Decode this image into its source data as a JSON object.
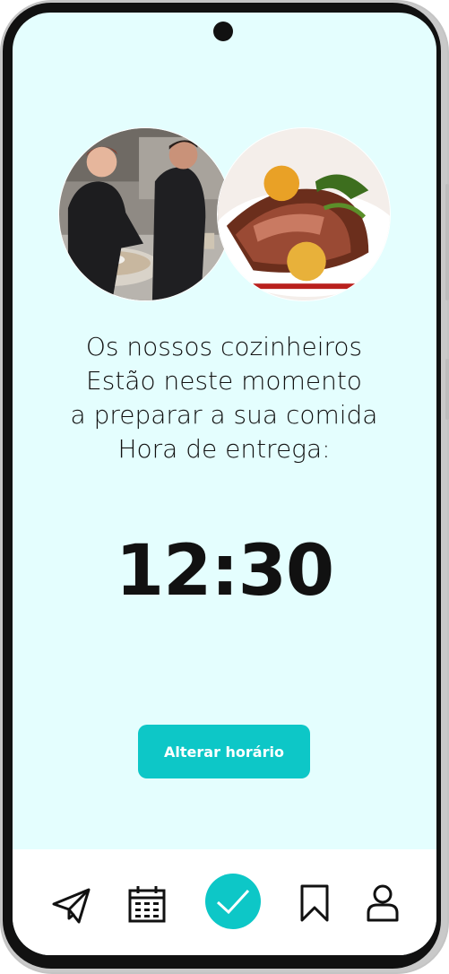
{
  "message": {
    "line1": "Os nossos cozinheiros",
    "line2": "Estão neste momento",
    "line3": "a preparar a sua comida",
    "line4": "Hora de entrega:"
  },
  "delivery_time": "12:30",
  "change_button_label": "Alterar horário",
  "colors": {
    "accent": "#0dc7c7",
    "screen_background": "#e4fefe",
    "text": "#111111"
  },
  "nav": {
    "items": [
      {
        "icon": "paper-plane-icon"
      },
      {
        "icon": "calendar-icon"
      },
      {
        "icon": "checkmark-icon",
        "active": true
      },
      {
        "icon": "bookmark-icon"
      },
      {
        "icon": "user-icon"
      }
    ]
  },
  "images": [
    {
      "subject": "chefs-cooking-photo"
    },
    {
      "subject": "plated-dish-photo"
    }
  ]
}
